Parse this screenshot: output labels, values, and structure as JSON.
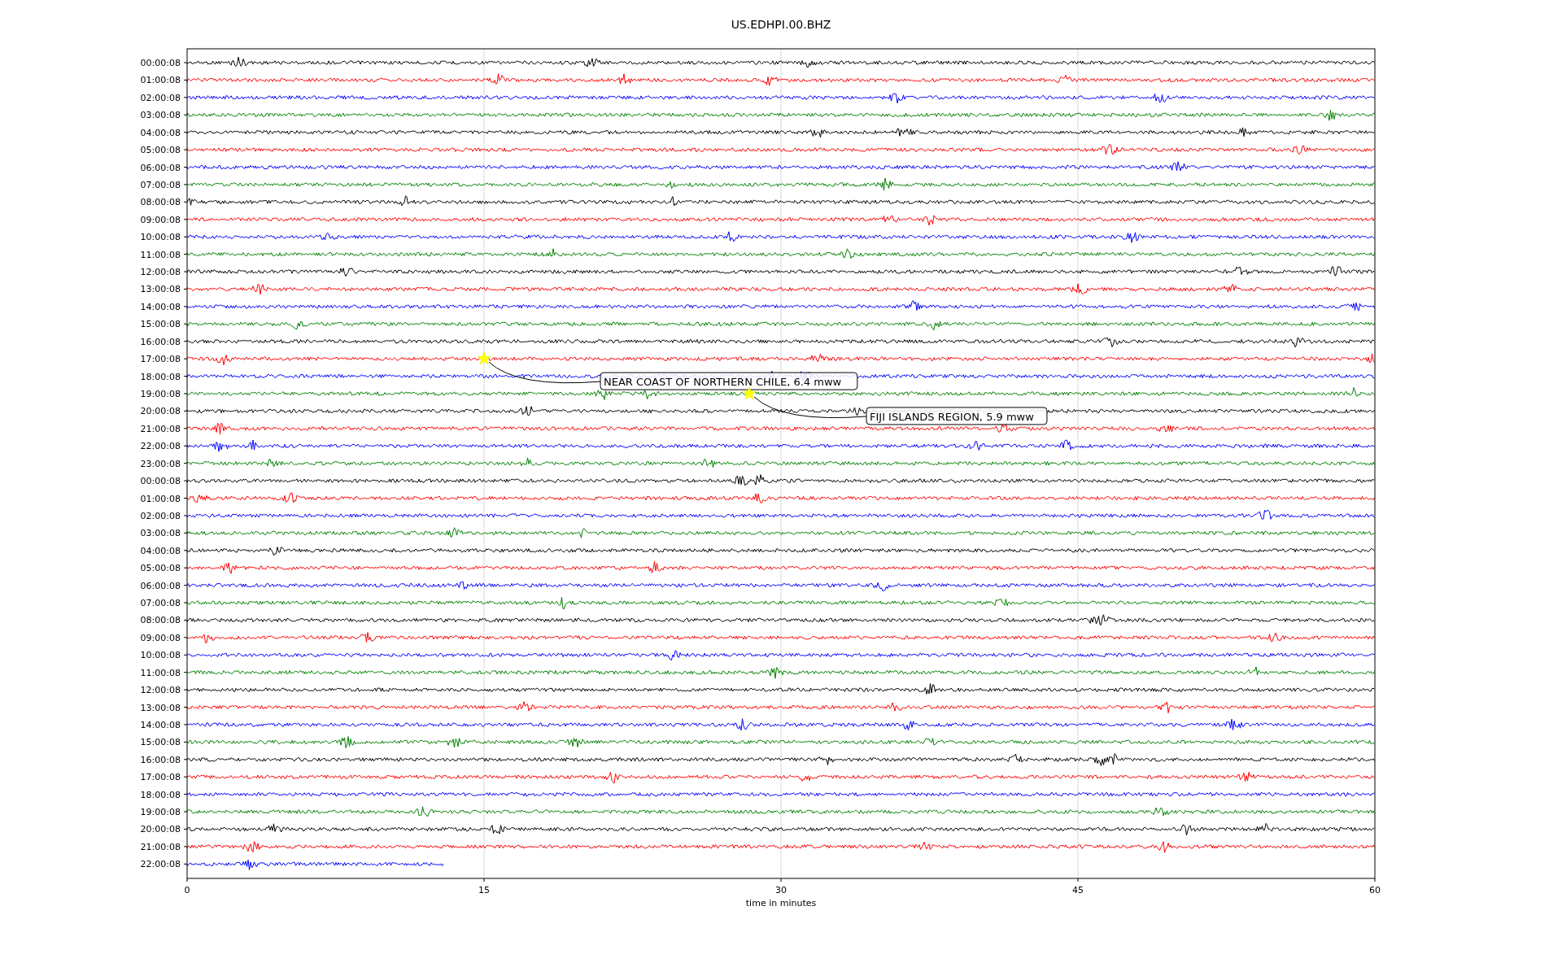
{
  "title": "US.EDHPI.00.BHZ",
  "xlabel": "time in minutes",
  "xticks": [
    "0",
    "15",
    "30",
    "45",
    "60"
  ],
  "rows": [
    {
      "label": "00:00:08",
      "color": "#000000",
      "level": 1
    },
    {
      "label": "01:00:08",
      "color": "#ff0000",
      "level": 1
    },
    {
      "label": "02:00:08",
      "color": "#0000ff",
      "level": 1
    },
    {
      "label": "03:00:08",
      "color": "#008000",
      "level": 1
    },
    {
      "label": "04:00:08",
      "color": "#000000",
      "level": 1
    },
    {
      "label": "05:00:08",
      "color": "#ff0000",
      "level": 1
    },
    {
      "label": "06:00:08",
      "color": "#0000ff",
      "level": 1
    },
    {
      "label": "07:00:08",
      "color": "#008000",
      "level": 1
    },
    {
      "label": "08:00:08",
      "color": "#000000",
      "level": 1
    },
    {
      "label": "09:00:08",
      "color": "#ff0000",
      "level": 1
    },
    {
      "label": "10:00:08",
      "color": "#0000ff",
      "level": 1
    },
    {
      "label": "11:00:08",
      "color": "#008000",
      "level": 1
    },
    {
      "label": "12:00:08",
      "color": "#000000",
      "level": 1
    },
    {
      "label": "13:00:08",
      "color": "#ff0000",
      "level": 1
    },
    {
      "label": "14:00:08",
      "color": "#0000ff",
      "level": 1
    },
    {
      "label": "15:00:08",
      "color": "#008000",
      "level": 1
    },
    {
      "label": "16:00:08",
      "color": "#000000",
      "level": 1
    },
    {
      "label": "17:00:08",
      "color": "#ff0000",
      "level": 1,
      "event": "NEAR COAST OF NORTHERN CHILE, 6.4 mww"
    },
    {
      "label": "18:00:08",
      "color": "#0000ff",
      "level": 1
    },
    {
      "label": "19:00:08",
      "color": "#008000",
      "level": 1,
      "event": "FIJI ISLANDS REGION, 5.9 mww"
    },
    {
      "label": "20:00:08",
      "color": "#000000",
      "level": 1
    },
    {
      "label": "21:00:08",
      "color": "#ff0000",
      "level": 1
    },
    {
      "label": "22:00:08",
      "color": "#0000ff",
      "level": 1
    },
    {
      "label": "23:00:08",
      "color": "#008000",
      "level": 1
    },
    {
      "label": "00:00:08",
      "color": "#000000",
      "level": 1
    },
    {
      "label": "01:00:08",
      "color": "#ff0000",
      "level": 1
    },
    {
      "label": "02:00:08",
      "color": "#0000ff",
      "level": 1
    },
    {
      "label": "03:00:08",
      "color": "#008000",
      "level": 1
    },
    {
      "label": "04:00:08",
      "color": "#000000",
      "level": 1
    },
    {
      "label": "05:00:08",
      "color": "#ff0000",
      "level": 1
    },
    {
      "label": "06:00:08",
      "color": "#0000ff",
      "level": 1
    },
    {
      "label": "07:00:08",
      "color": "#008000",
      "level": 1
    },
    {
      "label": "08:00:08",
      "color": "#000000",
      "level": 1
    },
    {
      "label": "09:00:08",
      "color": "#ff0000",
      "level": 1
    },
    {
      "label": "10:00:08",
      "color": "#0000ff",
      "level": 1
    },
    {
      "label": "11:00:08",
      "color": "#008000",
      "level": 1
    },
    {
      "label": "12:00:08",
      "color": "#000000",
      "level": 1
    },
    {
      "label": "13:00:08",
      "color": "#ff0000",
      "level": 1
    },
    {
      "label": "14:00:08",
      "color": "#0000ff",
      "level": 1
    },
    {
      "label": "15:00:08",
      "color": "#008000",
      "level": 1
    },
    {
      "label": "16:00:08",
      "color": "#000000",
      "level": 1
    },
    {
      "label": "17:00:08",
      "color": "#ff0000",
      "level": 1
    },
    {
      "label": "18:00:08",
      "color": "#0000ff",
      "level": 1
    },
    {
      "label": "19:00:08",
      "color": "#008000",
      "level": 1
    },
    {
      "label": "20:00:08",
      "color": "#000000",
      "level": 1
    },
    {
      "label": "21:00:08",
      "color": "#ff0000",
      "level": 1
    },
    {
      "label": "22:00:08",
      "color": "#0000ff",
      "level": 0.216
    }
  ]
}
